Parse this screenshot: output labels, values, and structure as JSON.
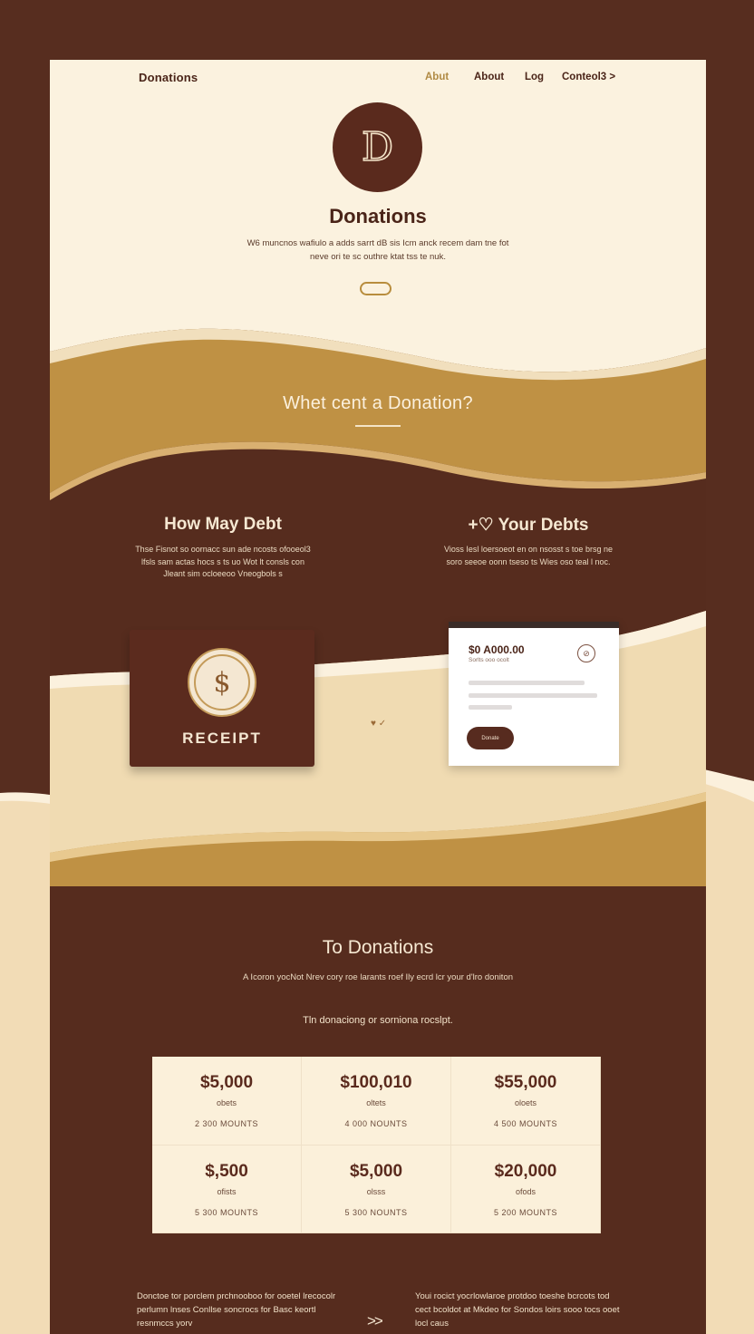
{
  "nav": {
    "brand": "Donations",
    "links": [
      "Abut",
      "About",
      "Log",
      "Conteol3 >"
    ]
  },
  "hero": {
    "logo_letter": "D",
    "title": "Donations",
    "text": "W6 muncnos wafiulo a adds sarrt dB sis Icm anck recem dam tne fot neve ori te sc outhre ktat tss te nuk."
  },
  "section2": {
    "title": "Whet cent a Donation?"
  },
  "left_col": {
    "title": "How May Debt",
    "text": "Thse Fisnot so oornacc sun ade ncosts ofooeol3 lfsls sam actas hocs s ts uo Wot lt consls con Jleant sim ocloeeoo Vneogbols s"
  },
  "right_col": {
    "title": "+♡ Your Debts",
    "text": "Vioss Iesl loersoeot en on nsosst s toe brsg ne soro seeoe oonn tseso ts Wies oso teal l noc."
  },
  "receipt": {
    "symbol": "$",
    "label": "RECEIPT"
  },
  "mid_mark": "♥ ✓",
  "mock": {
    "amount": "$0 A000.00",
    "sub": "Sorlts ooo ocolt",
    "icon": "⊘",
    "button": "Donate"
  },
  "section3": {
    "title": "To Donations",
    "text": "A Icoron yocNot Nrev cory roe larants roef Ily ecrd lcr your d'lro doniton",
    "subtitle": "Tln donaciong or sorniona rocslpt."
  },
  "table": [
    {
      "amount": "$5,000",
      "label": "obets",
      "count": "2 300 MOUNTS"
    },
    {
      "amount": "$100,010",
      "label": "oltets",
      "count": "4 000 NOUNTS"
    },
    {
      "amount": "$55,000",
      "label": "oloets",
      "count": "4 500 MOUNTS"
    },
    {
      "amount": "$,500",
      "label": "ofists",
      "count": "5 300 MOUNTS"
    },
    {
      "amount": "$5,000",
      "label": "olsss",
      "count": "5 300 NOUNTS"
    },
    {
      "amount": "$20,000",
      "label": "ofods",
      "count": "5 200 MOUNTS"
    }
  ],
  "footer": {
    "left": "Donctoe tor porclem prchnooboo for ooetel lrecocolr perlumn lnses Conllse soncrocs for Basc keortl resnmccs yorv",
    "right": "Youi rocict yocrlowlaroe protdoo toeshe bcrcots tod cect bcoldot at Mkdeo for Sondos loirs sooo tocs ooet locl caus",
    "arrow": ">>"
  },
  "colors": {
    "dark_brown": "#562c1e",
    "cream": "#fbf2df",
    "gold": "#bf9144",
    "tan": "#efd9b0"
  }
}
